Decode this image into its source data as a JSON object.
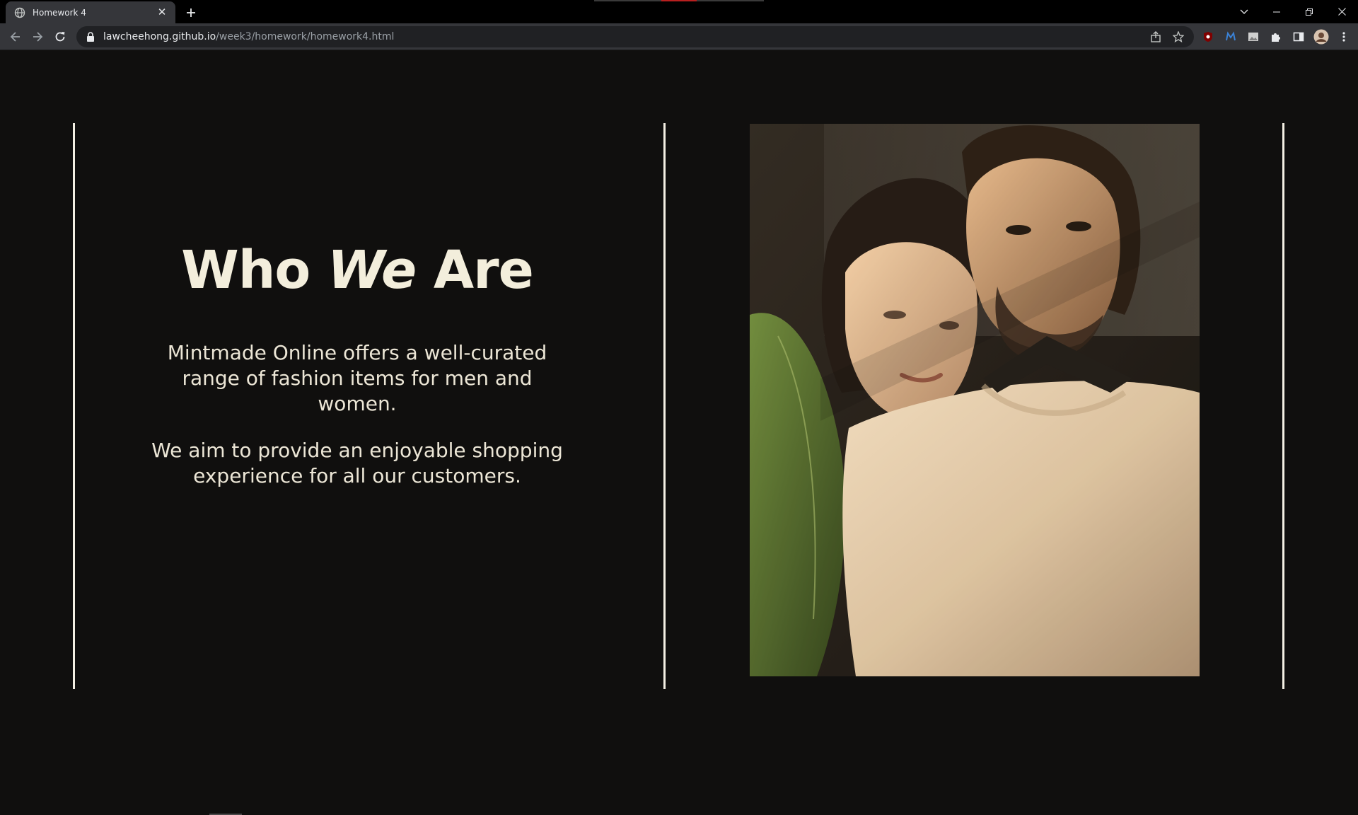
{
  "browser": {
    "tab_title": "Homework 4",
    "url_host": "lawcheehong.github.io",
    "url_path": "/week3/homework/homework4.html",
    "tab_close": "✕",
    "new_tab": "+"
  },
  "page": {
    "heading_part1": "Who ",
    "heading_em": "We",
    "heading_part2": " Are",
    "paragraph_1": "Mintmade Online offers a well-curated range of fashion items for men and women.",
    "paragraph_2": "We aim to provide an enjoyable shopping experience for all our customers.",
    "photo_alt": "Couple portrait"
  },
  "colors": {
    "background": "#100f0e",
    "text": "#f1ecdc",
    "divider": "#f3efe3"
  }
}
